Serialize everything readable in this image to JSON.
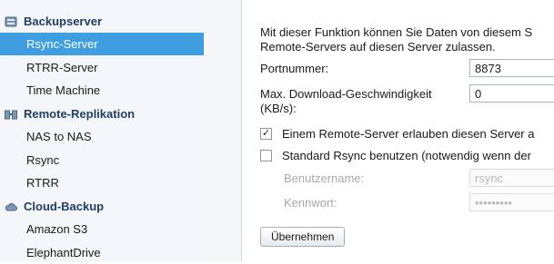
{
  "sidebar": {
    "groups": [
      {
        "label": "Backupserver",
        "icon": "backup-server-icon",
        "items": [
          "Rsync-Server",
          "RTRR-Server",
          "Time Machine"
        ]
      },
      {
        "label": "Remote-Replikation",
        "icon": "remote-replication-icon",
        "items": [
          "NAS to NAS",
          "Rsync",
          "RTRR"
        ]
      },
      {
        "label": "Cloud-Backup",
        "icon": "cloud-icon",
        "items": [
          "Amazon S3",
          "ElephantDrive"
        ]
      }
    ],
    "selected": "Rsync-Server"
  },
  "main": {
    "description_line1": "Mit dieser Funktion können Sie Daten von diesem S",
    "description_line2": "Remote-Servers auf diesen Server zulassen.",
    "port_label": "Portnummer:",
    "port_value": "8873",
    "speed_label_line1": "Max. Download-Geschwindigkeit",
    "speed_label_line2": "(KB/s):",
    "speed_value": "0",
    "checkbox_remote_label": "Einem Remote-Server erlauben diesen Server a",
    "checkbox_remote_checked": true,
    "checkbox_std_label": "Standard Rsync benutzen (notwendig wenn der",
    "checkbox_std_checked": false,
    "username_label": "Benutzername:",
    "username_value": "rsync",
    "password_label": "Kennwort:",
    "password_value": "•••••••••",
    "apply_label": "Übernehmen"
  },
  "colors": {
    "selected_bg": "#3e9ee0",
    "group_text": "#1f3f66"
  }
}
